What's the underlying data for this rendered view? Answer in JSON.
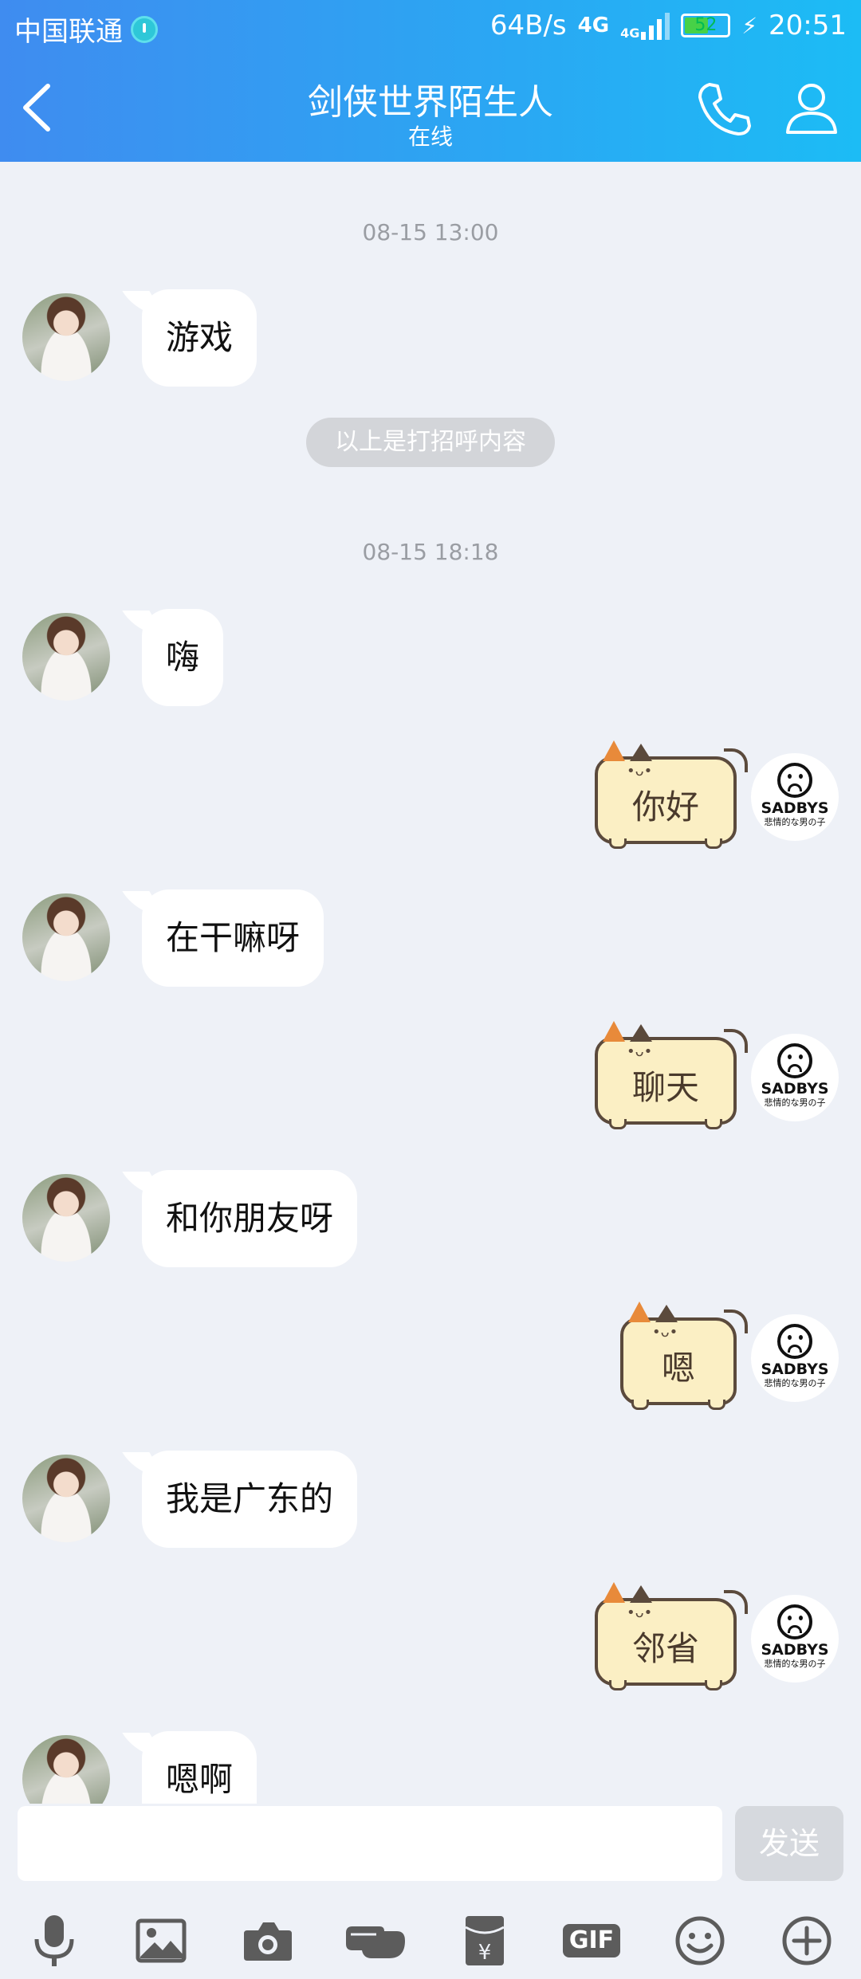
{
  "status_bar": {
    "carrier": "中国联通",
    "speed": "64B/s",
    "network_a": "4G",
    "network_b": "4G",
    "battery": "52",
    "time": "20:51"
  },
  "header": {
    "title": "剑侠世界陌生人",
    "subtitle": "在线"
  },
  "messages": {
    "t1": "08-15 13:00",
    "m1": "游戏",
    "notice": "以上是打招呼内容",
    "t2": "08-15 18:18",
    "m2": "嗨",
    "r1": "你好",
    "m3": "在干嘛呀",
    "r2": "聊天",
    "m4": "和你朋友呀",
    "r3": "嗯",
    "m5": "我是广东的",
    "r4": "邻省",
    "m6": "嗯啊"
  },
  "self_avatar": {
    "brand": "SADBYS",
    "sub": "悲情的な男の子"
  },
  "input": {
    "value": "",
    "send_label": "发送",
    "gif_label": "GIF"
  },
  "colors": {
    "header_start": "#3f8cf0",
    "header_end": "#1cbcf5",
    "chat_bg": "#eef1f7",
    "bubble": "#ffffff",
    "cat_bubble": "#fbefc4"
  }
}
